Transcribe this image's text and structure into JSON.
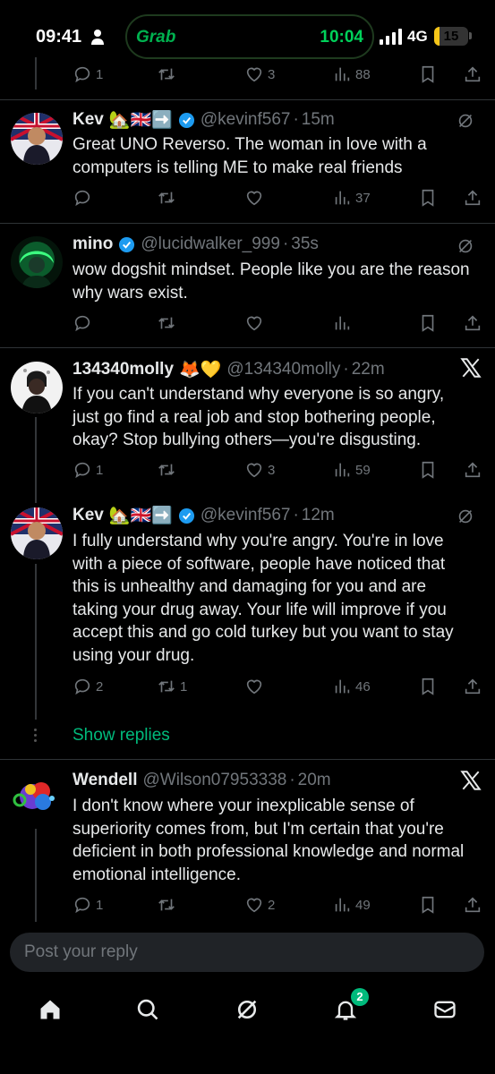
{
  "status_bar": {
    "time": "09:41",
    "app_pill_brand": "Grab",
    "app_pill_time": "10:04",
    "network": "4G",
    "battery": "15",
    "battery_level": 0.15
  },
  "top_partial": {
    "reply_count": "1",
    "retweet_count": "",
    "like_count": "3",
    "view_count": "88"
  },
  "tweets": [
    {
      "name": "Kev",
      "emoji": "🏡🇬🇧➡️",
      "verified": true,
      "handle": "@kevinf567",
      "time": "15m",
      "text": "Great UNO Reverso. The woman in love with a computers is telling ME to make real friends",
      "replies": "",
      "retweets": "",
      "likes": "",
      "views": "37"
    },
    {
      "name": "mino",
      "emoji": "",
      "verified": true,
      "handle": "@lucidwalker_999",
      "time": "35s",
      "text": "wow dogshit mindset. People like you are the reason why wars exist.",
      "replies": "",
      "retweets": "",
      "likes": "",
      "views": ""
    },
    {
      "name": "134340molly",
      "emoji": "🦊💛",
      "verified": false,
      "handle": "@134340molly",
      "time": "22m",
      "text": "If you can't understand why everyone is so angry, just go find a real job and stop bothering people, okay? Stop bullying others—you're disgusting.",
      "replies": "1",
      "retweets": "",
      "likes": "3",
      "views": "59"
    },
    {
      "name": "Kev",
      "emoji": "🏡🇬🇧➡️",
      "verified": true,
      "handle": "@kevinf567",
      "time": "12m",
      "text": "I fully understand why you're angry. You're in love with a piece of software, people have noticed that this is unhealthy and damaging for you and are taking your drug away. Your life will improve if you accept this and go cold turkey but you want to stay using your drug.",
      "replies": "2",
      "retweets": "1",
      "likes": "",
      "views": "46"
    },
    {
      "name": "Wendell",
      "emoji": "",
      "verified": false,
      "handle": "@Wilson07953338",
      "time": "20m",
      "text": "I don't know where your inexplicable sense of superiority comes from, but I'm certain that you're deficient in both professional knowledge and normal emotional intelligence.",
      "replies": "1",
      "retweets": "",
      "likes": "2",
      "views": "49"
    }
  ],
  "show_replies_label": "Show replies",
  "reply_placeholder": "Post your reply",
  "nav": {
    "notifications_badge": "2"
  },
  "colors": {
    "accent": "#00ba7c",
    "background": "#000000",
    "muted": "#71767b",
    "verified": "#1d9bf0"
  }
}
